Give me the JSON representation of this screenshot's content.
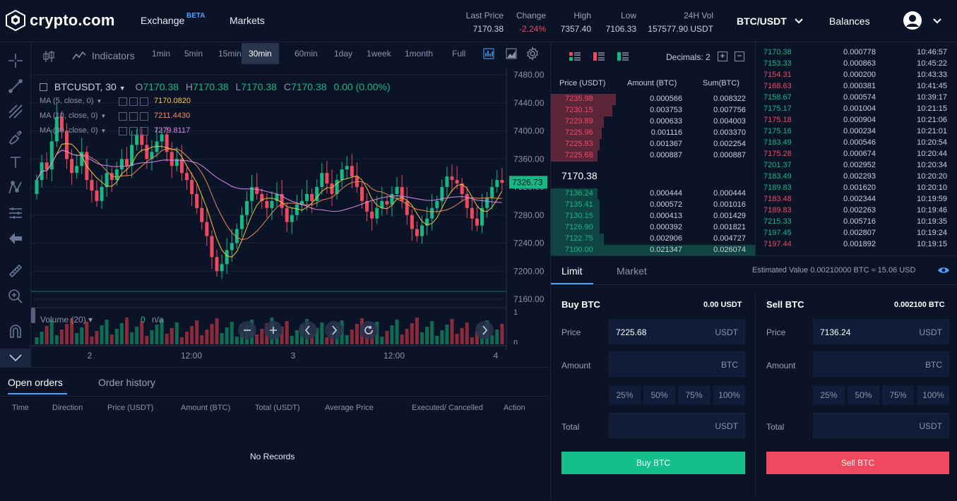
{
  "header": {
    "logo_text": "crypto.com",
    "nav": {
      "exchange": "Exchange",
      "beta": "BETA",
      "markets": "Markets"
    },
    "stats": [
      {
        "label": "Last Price",
        "value": "7170.38",
        "color": "#c9d1e0"
      },
      {
        "label": "Change",
        "value": "-2.24%",
        "color": "#f0495f"
      },
      {
        "label": "High",
        "value": "7357.40",
        "color": "#c9d1e0"
      },
      {
        "label": "Low",
        "value": "7106.33",
        "color": "#c9d1e0"
      },
      {
        "label": "24H Vol",
        "value": "157577.90 USDT",
        "color": "#c9d1e0"
      }
    ],
    "pair": "BTC/USDT",
    "balances": "Balances"
  },
  "chart_toolbar": {
    "indicators": "Indicators",
    "timeframes": [
      "1min",
      "5min",
      "15min",
      "30min",
      "60min",
      "1day",
      "1week",
      "1month",
      "Full"
    ],
    "active_timeframe": "30min"
  },
  "chart": {
    "symbol": "BTCUSDT, 30",
    "ohlc": {
      "o_label": "O",
      "o": "7170.38",
      "h_label": "H",
      "h": "7170.38",
      "l_label": "L",
      "l": "7170.38",
      "c_label": "C",
      "c": "7170.38",
      "chg": "0.00 (0.00%)"
    },
    "ma": [
      {
        "label": "MA (5, close, 0)",
        "value": "7170.0820",
        "color": "#f5c842"
      },
      {
        "label": "MA (10, close, 0)",
        "value": "7211.4430",
        "color": "#f08a5d"
      },
      {
        "label": "MA (30, close, 0)",
        "value": "7279.8117",
        "color": "#d98cf0"
      }
    ],
    "price_axis": [
      "7480.00",
      "7440.00",
      "7400.00",
      "7360.00",
      "7320.00",
      "7280.00",
      "7240.00",
      "7200.00",
      "7160.00"
    ],
    "current_price_tag": "7326.73",
    "volume_label": "Volume (20)",
    "volume_value": "0",
    "volume_na": "n/a",
    "volume_axis_top": "1",
    "volume_axis_bottom": "n",
    "time_axis": [
      "2",
      "12:00",
      "3",
      "12:00",
      "4"
    ]
  },
  "orderbook": {
    "decimals_label": "Decimals: 2",
    "columns": [
      "Price (USDT)",
      "Amount (BTC)",
      "Sum(BTC)"
    ],
    "asks": [
      {
        "price": "7235.98",
        "amount": "0.000566",
        "sum": "0.008322",
        "depth": 0.32
      },
      {
        "price": "7230.15",
        "amount": "0.003753",
        "sum": "0.007756",
        "depth": 0.3
      },
      {
        "price": "7229.89",
        "amount": "0.000633",
        "sum": "0.004003",
        "depth": 0.26
      },
      {
        "price": "7225.96",
        "amount": "0.001116",
        "sum": "0.003370",
        "depth": 0.25
      },
      {
        "price": "7225.83",
        "amount": "0.001367",
        "sum": "0.002254",
        "depth": 0.24
      },
      {
        "price": "7225.68",
        "amount": "0.000887",
        "sum": "0.000887",
        "depth": 0.23
      }
    ],
    "mid_price": "7170.38",
    "bids": [
      {
        "price": "7136.24",
        "amount": "0.000444",
        "sum": "0.000444",
        "depth": 0.23
      },
      {
        "price": "7135.41",
        "amount": "0.000572",
        "sum": "0.001016",
        "depth": 0.24
      },
      {
        "price": "7130.15",
        "amount": "0.000413",
        "sum": "0.001429",
        "depth": 0.24
      },
      {
        "price": "7126.90",
        "amount": "0.000392",
        "sum": "0.001821",
        "depth": 0.24
      },
      {
        "price": "7122.75",
        "amount": "0.002906",
        "sum": "0.004727",
        "depth": 0.26
      },
      {
        "price": "7100.00",
        "amount": "0.021347",
        "sum": "0.026074",
        "depth": 1.0
      }
    ]
  },
  "trades": [
    {
      "price": "7170.38",
      "amount": "0.000778",
      "time": "10:46:57",
      "side": "buy"
    },
    {
      "price": "7153.33",
      "amount": "0.000863",
      "time": "10:45:22",
      "side": "buy"
    },
    {
      "price": "7154.31",
      "amount": "0.000200",
      "time": "10:43:33",
      "side": "sell"
    },
    {
      "price": "7168.63",
      "amount": "0.000381",
      "time": "10:41:45",
      "side": "sell"
    },
    {
      "price": "7158.67",
      "amount": "0.000574",
      "time": "10:39:17",
      "side": "buy"
    },
    {
      "price": "7175.17",
      "amount": "0.001004",
      "time": "10:21:15",
      "side": "buy"
    },
    {
      "price": "7175.18",
      "amount": "0.000904",
      "time": "10:21:06",
      "side": "sell"
    },
    {
      "price": "7175.16",
      "amount": "0.000234",
      "time": "10:21:01",
      "side": "buy"
    },
    {
      "price": "7183.49",
      "amount": "0.000546",
      "time": "10:20:54",
      "side": "buy"
    },
    {
      "price": "7175.28",
      "amount": "0.000674",
      "time": "10:20:44",
      "side": "sell"
    },
    {
      "price": "7201.37",
      "amount": "0.002952",
      "time": "10:20:34",
      "side": "buy"
    },
    {
      "price": "7183.49",
      "amount": "0.002293",
      "time": "10:20:20",
      "side": "buy"
    },
    {
      "price": "7189.83",
      "amount": "0.001620",
      "time": "10:20:10",
      "side": "buy"
    },
    {
      "price": "7183.48",
      "amount": "0.002344",
      "time": "10:19:59",
      "side": "sell"
    },
    {
      "price": "7189.83",
      "amount": "0.002263",
      "time": "10:19:46",
      "side": "sell"
    },
    {
      "price": "7215.33",
      "amount": "0.005716",
      "time": "10:19:35",
      "side": "buy"
    },
    {
      "price": "7197.45",
      "amount": "0.002807",
      "time": "10:19:24",
      "side": "buy"
    },
    {
      "price": "7197.44",
      "amount": "0.001892",
      "time": "10:19:15",
      "side": "sell"
    }
  ],
  "order_form": {
    "tabs": [
      "Limit",
      "Market"
    ],
    "estimated_value": "Estimated Value 0.00210000 BTC ≈ 15.06 USD",
    "buy": {
      "title": "Buy BTC",
      "balance": "0.00 USDT",
      "price_label": "Price",
      "price_value": "7225.68",
      "price_unit": "USDT",
      "amount_label": "Amount",
      "amount_unit": "BTC",
      "total_label": "Total",
      "total_unit": "USDT",
      "button": "Buy BTC"
    },
    "sell": {
      "title": "Sell BTC",
      "balance": "0.002100 BTC",
      "price_label": "Price",
      "price_value": "7136.24",
      "price_unit": "USDT",
      "amount_label": "Amount",
      "amount_unit": "BTC",
      "total_label": "Total",
      "total_unit": "USDT",
      "button": "Sell BTC"
    },
    "percents": [
      "25%",
      "50%",
      "75%",
      "100%"
    ]
  },
  "orders_panel": {
    "tabs": [
      "Open orders",
      "Order history"
    ],
    "columns": [
      "Time",
      "Direction",
      "Price (USDT)",
      "Amount (BTC)",
      "Total (USDT)",
      "Average Price",
      "Executed/ Cancelled",
      "Action"
    ],
    "empty": "No Records"
  },
  "colors": {
    "up": "#17b884",
    "down": "#f0495f",
    "bg": "#0b1426",
    "accent": "#4aa3ff"
  }
}
